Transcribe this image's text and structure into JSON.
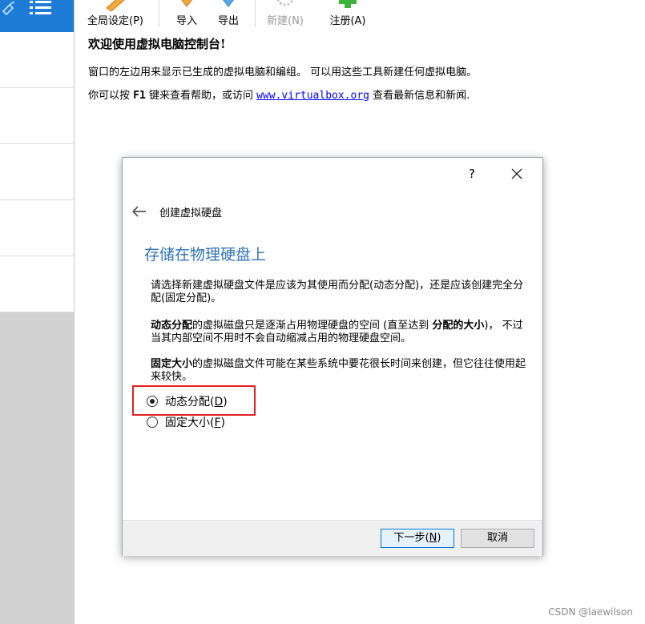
{
  "toolbar": {
    "items": [
      {
        "label": "全局设定(P)",
        "icon": "global-settings-icon",
        "enabled": true
      },
      {
        "label": "导入",
        "icon": "import-icon",
        "enabled": true
      },
      {
        "label": "导出",
        "icon": "export-icon",
        "enabled": true
      },
      {
        "label": "新建(N)",
        "icon": "new-icon",
        "enabled": false
      },
      {
        "label": "注册(A)",
        "icon": "add-icon",
        "enabled": true
      }
    ]
  },
  "welcome": {
    "title": "欢迎使用虚拟电脑控制台!",
    "line1": "窗口的左边用来显示已生成的虚拟电脑和编组。 可以用这些工具新建任何虚拟电脑。",
    "line2_pre": "你可以按",
    "line2_key": "F1",
    "line2_mid": "键来查看帮助，或访问",
    "line2_link": "www.virtualbox.org",
    "line2_post": "查看最新信息和新闻."
  },
  "dialog": {
    "help": "?",
    "wizard_title": "创建虚拟硬盘",
    "heading": "存储在物理硬盘上",
    "para1": "请选择新建虚拟硬盘文件是应该为其使用而分配(动态分配)，还是应该创建完全分配(固定分配)。",
    "para2_bold1": "动态分配",
    "para2_text1": "的虚拟磁盘只是逐渐占用物理硬盘的空间 (直至达到 ",
    "para2_bold2": "分配的大小",
    "para2_text2": ")， 不过当其内部空间不用时不会自动缩减占用的物理硬盘空间。",
    "para3_bold": "固定大小",
    "para3_text": "的虚拟磁盘文件可能在某些系统中要花很长时间来创建，但它往往使用起来较快。",
    "options": [
      {
        "label": "动态分配",
        "mnemonic": "D",
        "checked": true
      },
      {
        "label": "固定大小",
        "mnemonic": "F",
        "checked": false
      }
    ],
    "buttons": {
      "next_label": "下一步",
      "next_mnemonic": "N",
      "cancel_label": "取消"
    }
  },
  "watermark": "CSDN @laewilson",
  "colors": {
    "heading": "#2f73b7",
    "highlight": "#e02020",
    "selection": "#1c7cd6"
  }
}
